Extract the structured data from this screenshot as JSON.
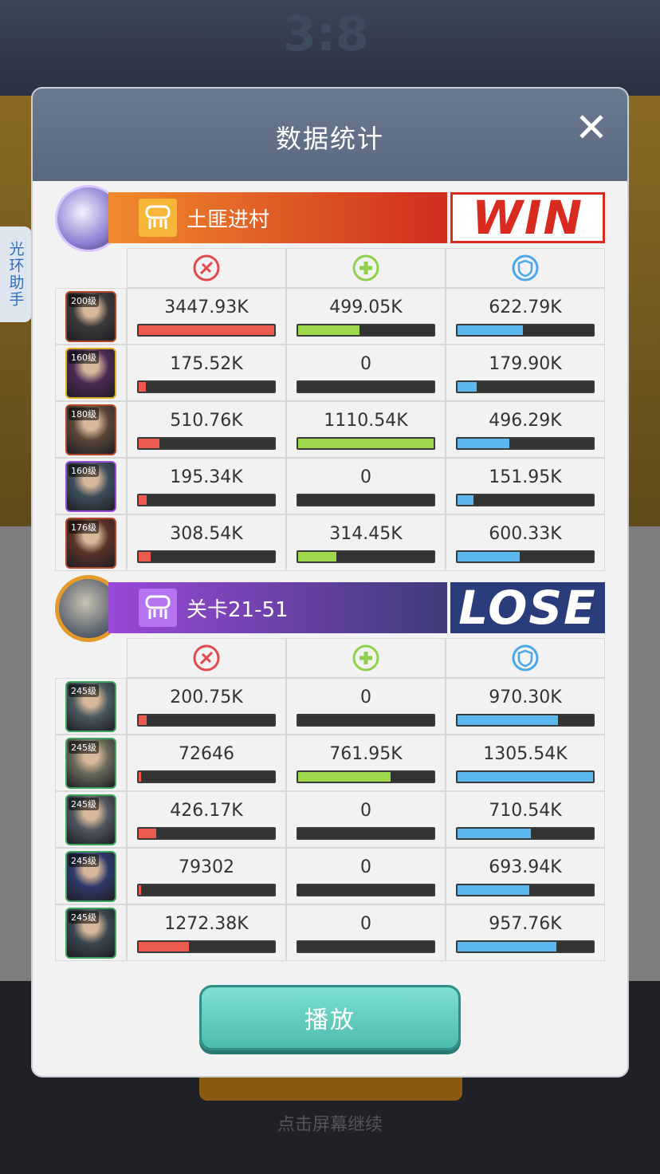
{
  "background": {
    "score": "3:8",
    "hint": "点击屏幕继续"
  },
  "side_tab": {
    "label": "光环助手"
  },
  "modal": {
    "title": "数据统计",
    "play_label": "播放"
  },
  "teams": [
    {
      "name": "土匪进村",
      "result": "WIN",
      "rows": [
        {
          "level": "200级",
          "border": "#b24a2a",
          "tint": "#3b3a3a",
          "damage": "3447.93K",
          "heal": "499.05K",
          "defense": "622.79K",
          "damage_pct": 100,
          "heal_pct": 45,
          "defense_pct": 48
        },
        {
          "level": "160级",
          "border": "#e0b020",
          "tint": "#4b2a54",
          "damage": "175.52K",
          "heal": "0",
          "defense": "179.90K",
          "damage_pct": 5,
          "heal_pct": 0,
          "defense_pct": 14
        },
        {
          "level": "180级",
          "border": "#b24a2a",
          "tint": "#5a4638",
          "damage": "510.76K",
          "heal": "1110.54K",
          "defense": "496.29K",
          "damage_pct": 15,
          "heal_pct": 100,
          "defense_pct": 38
        },
        {
          "level": "160级",
          "border": "#9a4ad8",
          "tint": "#3d4e5a",
          "damage": "195.34K",
          "heal": "0",
          "defense": "151.95K",
          "damage_pct": 6,
          "heal_pct": 0,
          "defense_pct": 12
        },
        {
          "level": "176级",
          "border": "#b24a2a",
          "tint": "#5a3228",
          "damage": "308.54K",
          "heal": "314.45K",
          "defense": "600.33K",
          "damage_pct": 9,
          "heal_pct": 28,
          "defense_pct": 46
        }
      ]
    },
    {
      "name": "关卡21-51",
      "result": "LOSE",
      "rows": [
        {
          "level": "245级",
          "border": "#3fa55a",
          "tint": "#4a5a60",
          "damage": "200.75K",
          "heal": "0",
          "defense": "970.30K",
          "damage_pct": 6,
          "heal_pct": 0,
          "defense_pct": 74
        },
        {
          "level": "245级",
          "border": "#3fa55a",
          "tint": "#6a6a5a",
          "damage": "72646",
          "heal": "761.95K",
          "defense": "1305.54K",
          "damage_pct": 2,
          "heal_pct": 68,
          "defense_pct": 100
        },
        {
          "level": "245级",
          "border": "#3fa55a",
          "tint": "#505660",
          "damage": "426.17K",
          "heal": "0",
          "defense": "710.54K",
          "damage_pct": 13,
          "heal_pct": 0,
          "defense_pct": 54
        },
        {
          "level": "245级",
          "border": "#3fa55a",
          "tint": "#2e3a6a",
          "damage": "79302",
          "heal": "0",
          "defense": "693.94K",
          "damage_pct": 2,
          "heal_pct": 0,
          "defense_pct": 53
        },
        {
          "level": "245级",
          "border": "#3fa55a",
          "tint": "#3a4650",
          "damage": "1272.38K",
          "heal": "0",
          "defense": "957.76K",
          "damage_pct": 37,
          "heal_pct": 0,
          "defense_pct": 73
        }
      ]
    }
  ],
  "stat_icons": [
    "damage-icon",
    "heal-icon",
    "defense-icon"
  ],
  "colors": {
    "damage": "#ea5a4e",
    "heal": "#9ed84b",
    "defense": "#5ab8ef",
    "win": "#d82a1e",
    "lose": "#2b3c7a"
  }
}
